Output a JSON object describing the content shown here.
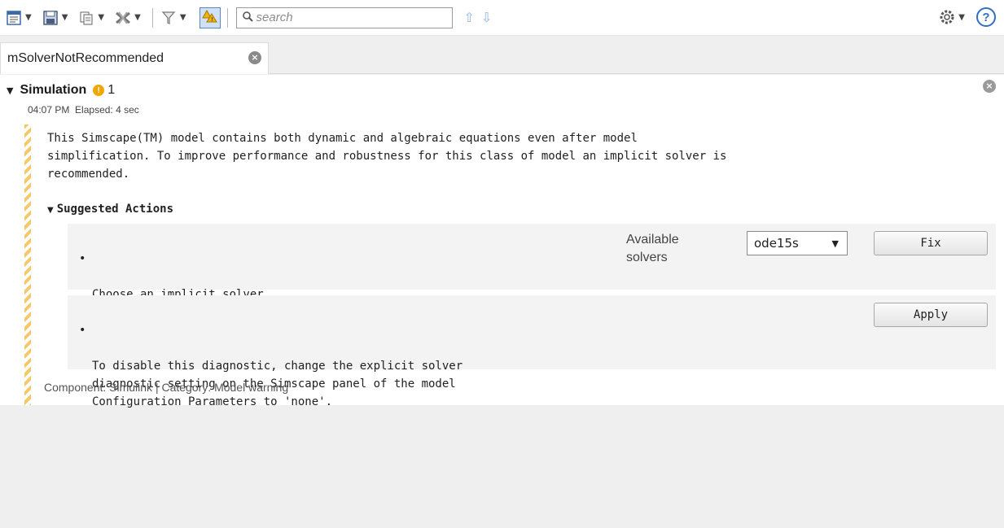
{
  "toolbar": {
    "search_placeholder": "search",
    "icons": [
      "report-icon",
      "save-icon",
      "copy-icon",
      "clear-icon",
      "filter-icon",
      "warnings-toggle-icon",
      "search-icon",
      "previous-icon",
      "next-icon",
      "settings-icon",
      "help-icon"
    ],
    "help_label": "?",
    "prev_glyph": "⇧",
    "next_glyph": "⇩"
  },
  "tab": {
    "label": "mSolverNotRecommended",
    "close_glyph": "×"
  },
  "simulation": {
    "title": "Simulation",
    "warning_count": "1",
    "time": "04:07 PM",
    "elapsed": "Elapsed: 4 sec",
    "message": "This Simscape(TM) model contains both dynamic and algebraic equations even after model\nsimplification. To improve performance and robustness for this class of model an implicit solver is\nrecommended.",
    "suggested_actions_label": "Suggested Actions",
    "actions": [
      {
        "text": "Choose an implicit solver.",
        "available_label": "Available\nsolvers",
        "solver_value": "ode15s",
        "button_label": "Fix"
      },
      {
        "text": "To disable this diagnostic, change the explicit solver\ndiagnostic setting on the Simscape panel of the model\nConfiguration Parameters to 'none'.",
        "button_label": "Apply"
      }
    ],
    "footer": "Component: Simulink | Category: Model warning"
  },
  "colors": {
    "warning": "#f0a800",
    "accent": "#2f6fc4",
    "hatch": "#f6c86a"
  }
}
